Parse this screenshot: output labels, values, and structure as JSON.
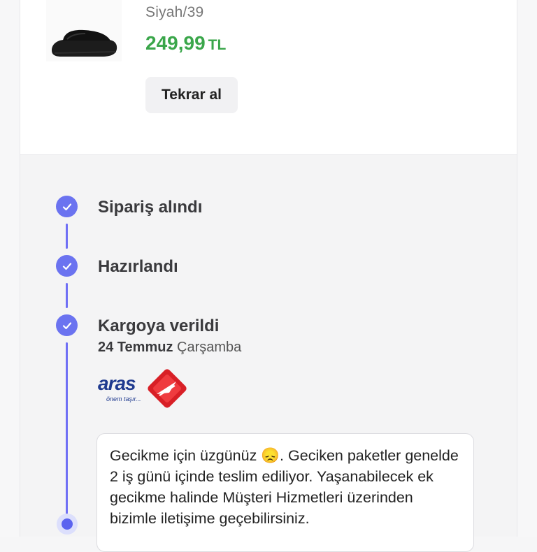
{
  "product": {
    "variant": "Siyah/39",
    "price": "249,99",
    "currency": "TL",
    "rebuy_label": "Tekrar al"
  },
  "timeline": {
    "steps": [
      {
        "label": "Sipariş alındı",
        "status": "completed"
      },
      {
        "label": "Hazırlandı",
        "status": "completed"
      },
      {
        "label": "Kargoya verildi",
        "status": "completed"
      }
    ],
    "shipped_date": "24 Temmuz",
    "shipped_day": "Çarşamba",
    "carrier": {
      "name": "aras",
      "slogan": "önem taşır...",
      "logo_color": "#e31e24",
      "text_color": "#1f3a8f"
    },
    "current_step_status": "in-progress",
    "delay_message": "Gecikme için üzgünüz 😞. Geciken paketler genelde 2 iş günü içinde teslim ediliyor. Yaşanabilecek ek gecikme halinde Müşteri Hizmetleri üzerinden bizimle iletişime geçebilirsiniz."
  },
  "colors": {
    "accent": "#6b73f0",
    "price": "#3aa64a"
  }
}
